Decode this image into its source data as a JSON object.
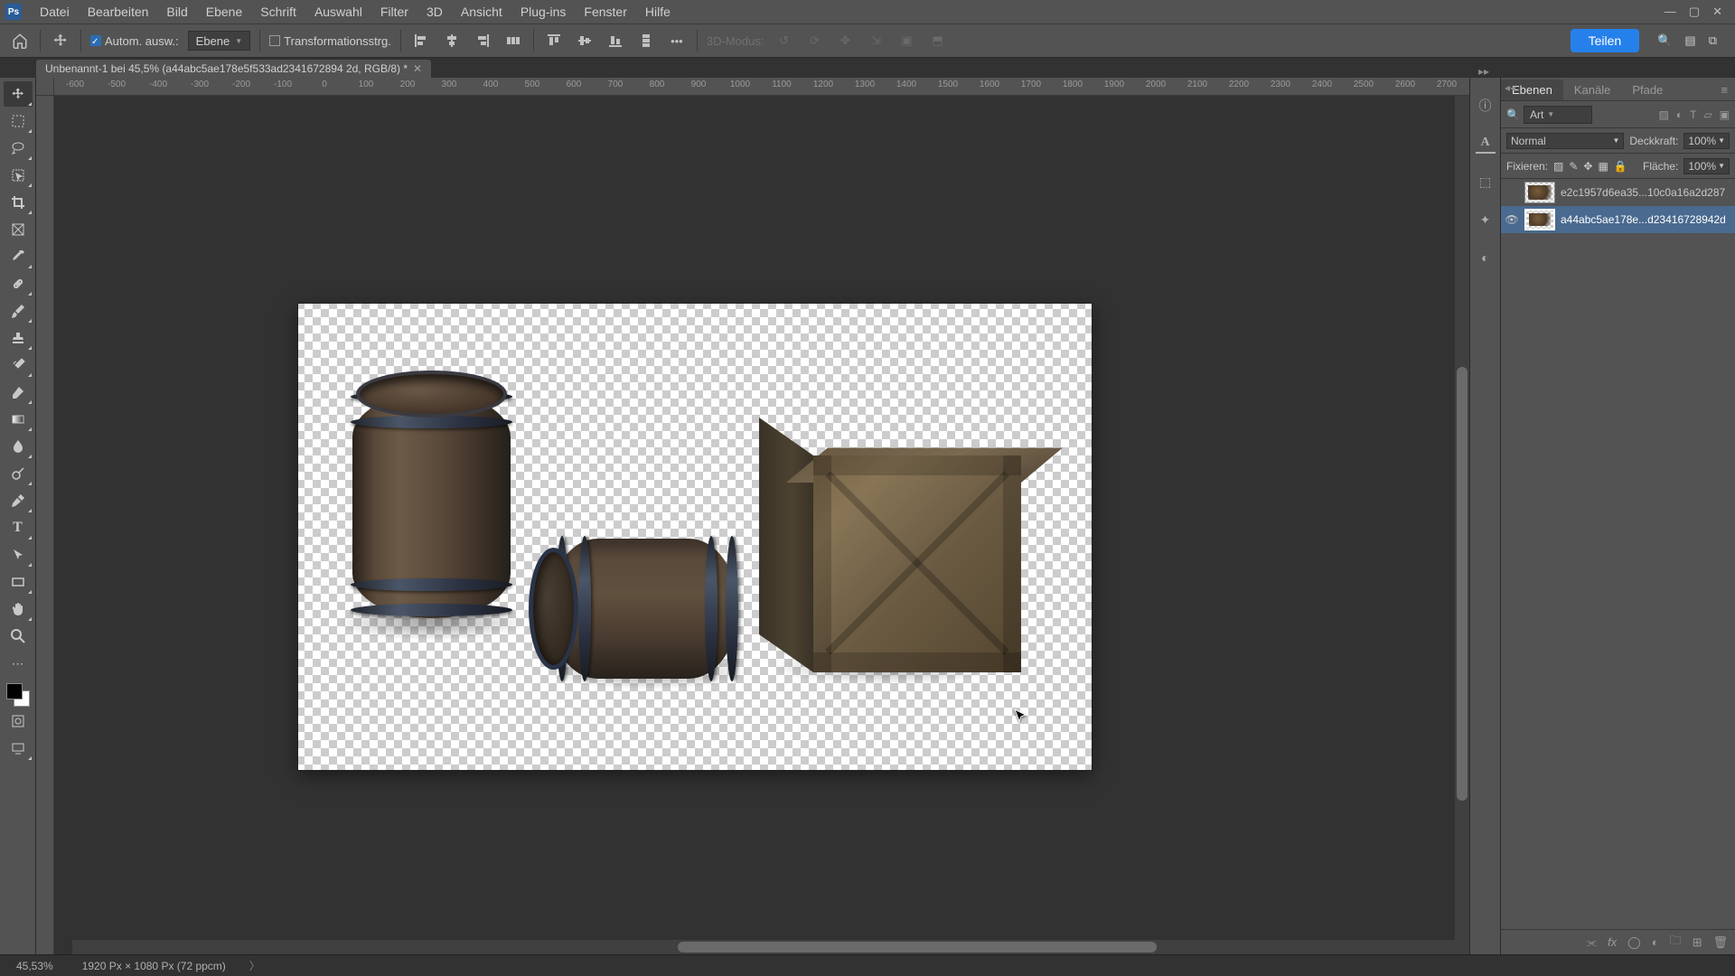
{
  "menubar": {
    "items": [
      "Datei",
      "Bearbeiten",
      "Bild",
      "Ebene",
      "Schrift",
      "Auswahl",
      "Filter",
      "3D",
      "Ansicht",
      "Plug-ins",
      "Fenster",
      "Hilfe"
    ]
  },
  "window": {
    "controls": [
      "minimize",
      "restore",
      "close"
    ]
  },
  "options": {
    "home_icon": "home",
    "tool_icon": "move",
    "auto_select_checked": true,
    "auto_select": "Autom. ausw.:",
    "auto_select_mode": "Ebene",
    "transform_checked": false,
    "transform": "Transformationsstrg.",
    "align_icons": [
      "align-left",
      "align-hcenter",
      "align-right",
      "align-justify",
      "align-top",
      "align-vcenter",
      "align-bottom",
      "distribute"
    ],
    "more": "•••",
    "mode_label": "3D-Modus:",
    "mode_icons": [
      "reset",
      "orbit",
      "pan",
      "dolly",
      "camera",
      "toggle"
    ],
    "share": "Teilen",
    "right_icons": [
      "search",
      "workspace",
      "popout"
    ]
  },
  "document": {
    "tab_title": "Unbenannt-1 bei 45,5% (a44abc5ae178e5f533ad2341672894 2d, RGB/8) *"
  },
  "ruler": {
    "values": [
      "-600",
      "-500",
      "-400",
      "-300",
      "-200",
      "-100",
      "0",
      "100",
      "200",
      "300",
      "400",
      "500",
      "600",
      "700",
      "800",
      "900",
      "1000",
      "1100",
      "1200",
      "1300",
      "1400",
      "1500",
      "1600",
      "1700",
      "1800",
      "1900",
      "2000",
      "2100",
      "2200",
      "2300",
      "2400",
      "2500",
      "2600",
      "2700"
    ]
  },
  "toolbox": {
    "tools": [
      {
        "name": "move",
        "icon": "↖"
      },
      {
        "name": "marquee",
        "icon": "▭"
      },
      {
        "name": "lasso",
        "icon": "⌇"
      },
      {
        "name": "magic-wand",
        "icon": "✧"
      },
      {
        "name": "crop",
        "icon": "⌗"
      },
      {
        "name": "frame",
        "icon": "◫"
      },
      {
        "name": "eyedropper",
        "icon": "✎"
      },
      {
        "name": "healing",
        "icon": "✚"
      },
      {
        "name": "brush",
        "icon": "🖌"
      },
      {
        "name": "stamp",
        "icon": "⛶"
      },
      {
        "name": "history-brush",
        "icon": "↺"
      },
      {
        "name": "eraser",
        "icon": "◪"
      },
      {
        "name": "gradient",
        "icon": "▤"
      },
      {
        "name": "blur",
        "icon": "💧"
      },
      {
        "name": "dodge",
        "icon": "🔆"
      },
      {
        "name": "pen",
        "icon": "✒"
      },
      {
        "name": "type",
        "icon": "T"
      },
      {
        "name": "path-select",
        "icon": "▷"
      },
      {
        "name": "rectangle",
        "icon": "□"
      },
      {
        "name": "hand",
        "icon": "✋"
      },
      {
        "name": "zoom",
        "icon": "🔍"
      },
      {
        "name": "more",
        "icon": "⋯"
      }
    ]
  },
  "dock": {
    "icons": [
      "info-panel",
      "character-panel",
      "3d-panel",
      "color-panel",
      "swatches-panel",
      "properties-panel"
    ]
  },
  "layers_panel": {
    "tabs": [
      "Ebenen",
      "Kanäle",
      "Pfade"
    ],
    "active_tab": 0,
    "search_icon": "search",
    "kind": "Art",
    "filter_icons": [
      "image",
      "adjustment",
      "type",
      "shape",
      "smart"
    ],
    "blend_label": "Normal",
    "opacity_label": "Deckkraft:",
    "opacity_value": "100%",
    "lock_label": "Fixieren:",
    "lock_icons": [
      "transparency",
      "pixels",
      "position",
      "artboard",
      "all"
    ],
    "fill_label": "Fläche:",
    "fill_value": "100%",
    "layers": [
      {
        "visible": false,
        "name": "e2c1957d6ea35...10c0a16a2d287",
        "selected": false
      },
      {
        "visible": true,
        "name": "a44abc5ae178e...d23416728942d",
        "selected": true
      }
    ],
    "footer_icons": [
      "link",
      "fx",
      "mask",
      "adjustment",
      "group",
      "new",
      "trash"
    ]
  },
  "statusbar": {
    "zoom": "45,53%",
    "doc_info": "1920 Px × 1080 Px (72 ppcm)"
  }
}
